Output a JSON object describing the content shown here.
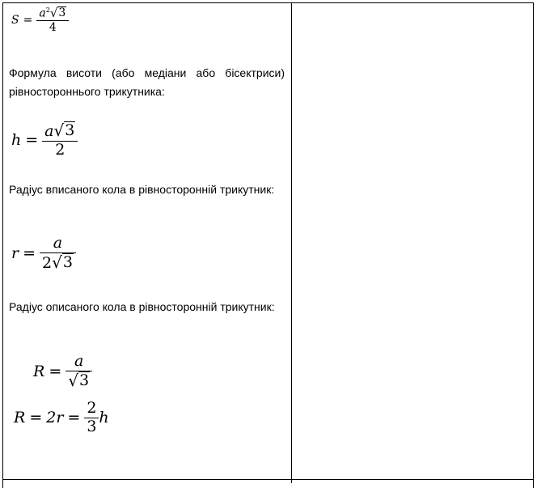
{
  "formulas": {
    "area": {
      "lhs": "S",
      "num_var": "a",
      "num_exp": "2",
      "num_root": "3",
      "den": "4"
    },
    "height": {
      "lhs": "h",
      "num_var": "a",
      "num_root": "3",
      "den": "2"
    },
    "inradius": {
      "lhs": "r",
      "num": "a",
      "den_coef": "2",
      "den_root": "3"
    },
    "circumradius": {
      "lhs": "R",
      "num": "a",
      "den_root": "3"
    },
    "relation": {
      "lhs": "R",
      "mid": "2r",
      "frac_num": "2",
      "frac_den": "3",
      "tail": "h"
    }
  },
  "texts": {
    "height_caption": "Формула висоти (або медіани або бісектриси) рівностороннього трикутника:",
    "inradius_caption": "Радіус вписаного кола в рівносторонній трикутник:",
    "circumradius_caption": "Радіус описаного кола в рівносторонній трикутник:"
  },
  "symbols": {
    "equals": "=",
    "radical": "√"
  }
}
